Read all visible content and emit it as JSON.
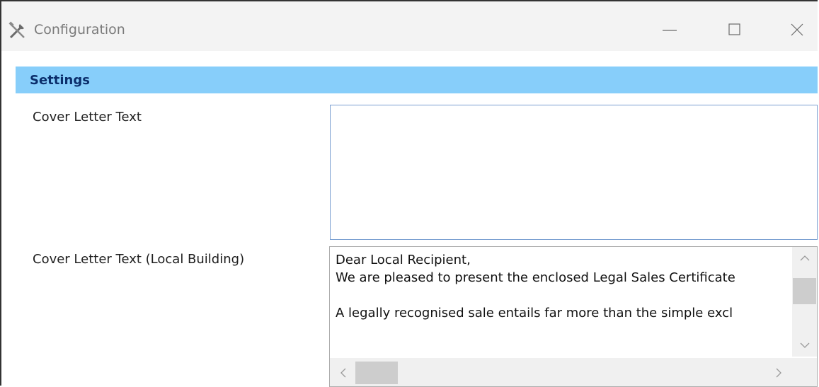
{
  "window": {
    "title": "Configuration",
    "icons": {
      "app": "tools-icon",
      "minimize": "minimize-icon",
      "maximize": "maximize-icon",
      "close": "close-icon"
    }
  },
  "section": {
    "title": "Settings",
    "color": "#87cefa"
  },
  "fields": [
    {
      "label": "Cover Letter Text",
      "value": ""
    },
    {
      "label": "Cover Letter Text (Local Building)",
      "lines": [
        "Dear Local Recipient,",
        "We are pleased to present the enclosed Legal Sales Certificate",
        "",
        "A legally recognised sale entails far more than the simple excl"
      ]
    }
  ]
}
